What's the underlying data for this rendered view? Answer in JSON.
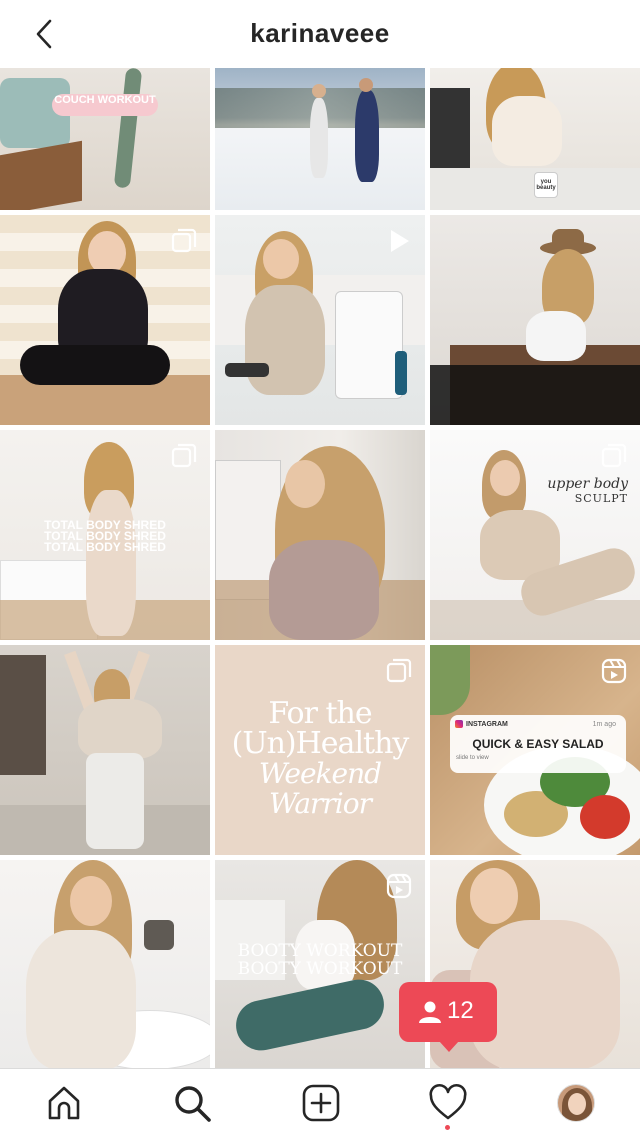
{
  "header": {
    "username": "karinaveee"
  },
  "posts": [
    {
      "overlay_tag": "COUCH WORKOUT"
    },
    {},
    {
      "mug_text": "you beauty"
    },
    {},
    {},
    {},
    {
      "overlay_text": [
        "TOTAL BODY SHRED",
        "TOTAL BODY SHRED",
        "TOTAL BODY SHRED"
      ]
    },
    {},
    {
      "overlay_script": "upper body",
      "overlay_caps": "SCULPT"
    },
    {},
    {
      "quote_line1": "For the",
      "quote_line2": "(Un)Healthy",
      "quote_line3": "Weekend Warrior"
    },
    {
      "card_app": "INSTAGRAM",
      "card_time": "1m ago",
      "card_title": "QUICK & EASY SALAD",
      "card_sub": "slide to view"
    },
    {},
    {
      "overlay_text": [
        "BOOTY WORKOUT",
        "BOOTY WORKOUT"
      ]
    },
    {}
  ],
  "notification": {
    "count": "12"
  },
  "nav": {
    "items": [
      "home-icon",
      "search-icon",
      "new-post-icon",
      "activity-heart-icon",
      "profile-avatar"
    ]
  },
  "colors": {
    "badge": "#ed4956",
    "text": "#262626"
  }
}
